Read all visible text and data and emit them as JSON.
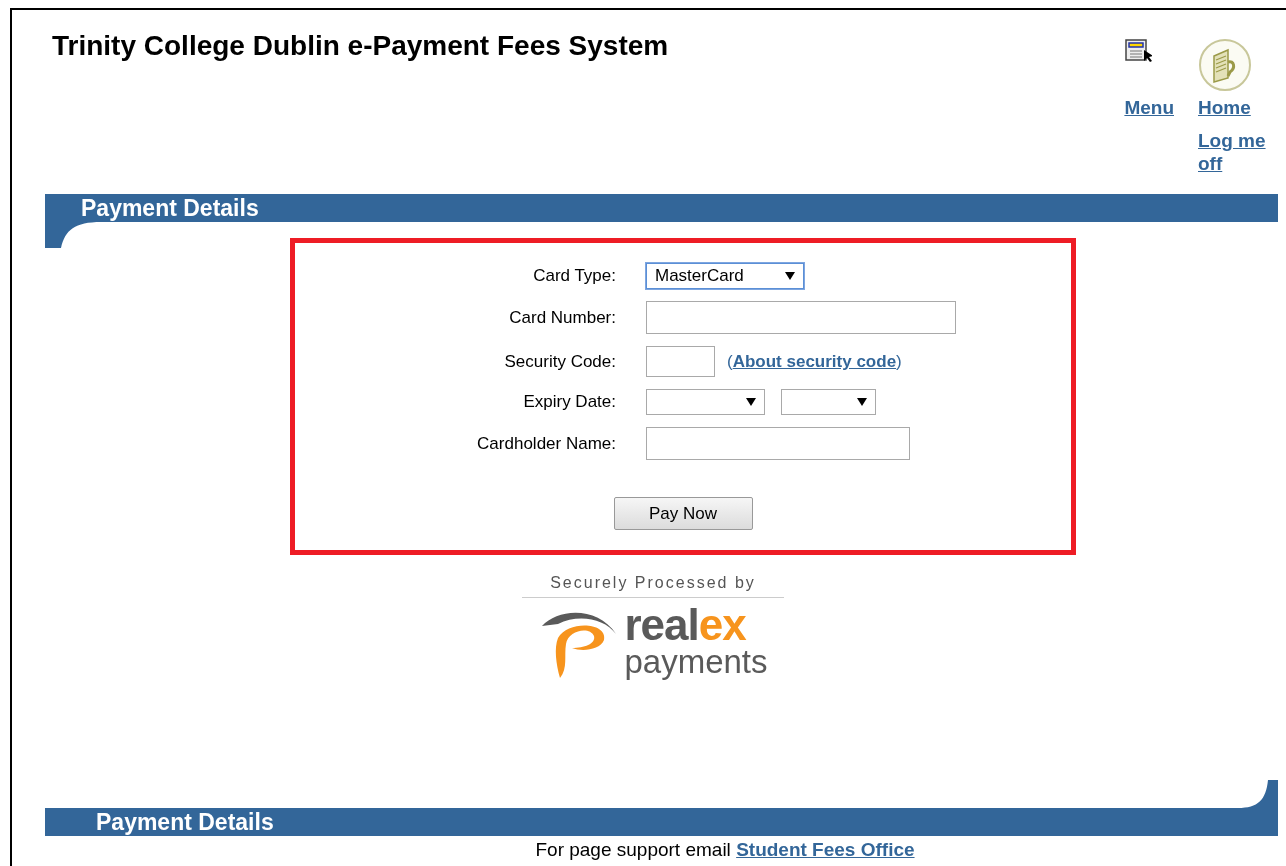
{
  "header": {
    "title": "Trinity College Dublin e-Payment Fees System"
  },
  "nav": [
    {
      "label": "Menu",
      "kind": "menu"
    },
    {
      "label": "Home",
      "kind": "home"
    }
  ],
  "logoff": "Log me off",
  "section_title": "Payment Details",
  "form": {
    "fields": [
      {
        "label": "Card Type:",
        "kind": "select",
        "value": "MasterCard"
      },
      {
        "label": "Card Number:",
        "kind": "text"
      },
      {
        "label": "Security Code:",
        "kind": "code",
        "open": "(",
        "link": "About security code",
        "close": ")"
      },
      {
        "label": "Expiry Date:",
        "kind": "date"
      },
      {
        "label": "Cardholder Name:",
        "kind": "name"
      }
    ],
    "button": "Pay Now"
  },
  "processor": {
    "caption": "Securely Processed by",
    "word_dark": "real",
    "word_accent": "ex",
    "word_second": "payments"
  },
  "footer": {
    "title": "Payment Details",
    "text": "For page support email",
    "link": "Student Fees Office"
  }
}
